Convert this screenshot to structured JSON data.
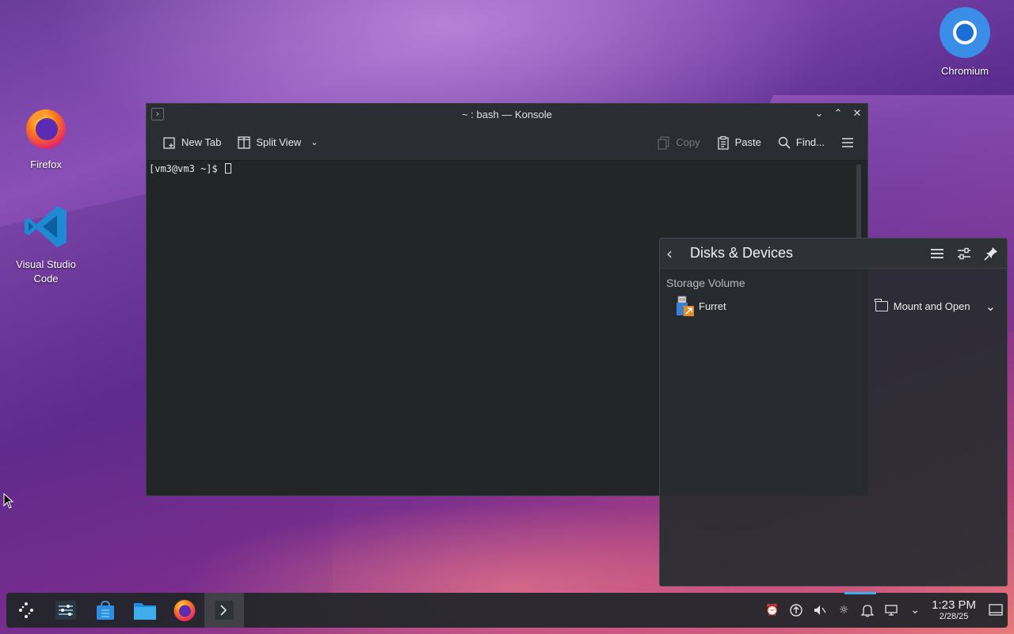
{
  "desktop": {
    "icons": [
      {
        "label": "Firefox"
      },
      {
        "label": "Visual Studio Code"
      },
      {
        "label": "Chromium"
      }
    ]
  },
  "konsole": {
    "title": "~ : bash — Konsole",
    "toolbar": {
      "new_tab": "New Tab",
      "split_view": "Split View",
      "copy": "Copy",
      "paste": "Paste",
      "find": "Find..."
    },
    "prompt": "[vm3@vm3 ~]$"
  },
  "disks_devices": {
    "title": "Disks & Devices",
    "section": "Storage Volume",
    "device": {
      "name": "Furret",
      "action": "Mount and Open"
    }
  },
  "taskbar": {
    "clock_time": "1:23 PM",
    "clock_date": "2/28/25"
  },
  "colors": {
    "accent": "#3daee9",
    "window_bg": "#232629"
  }
}
